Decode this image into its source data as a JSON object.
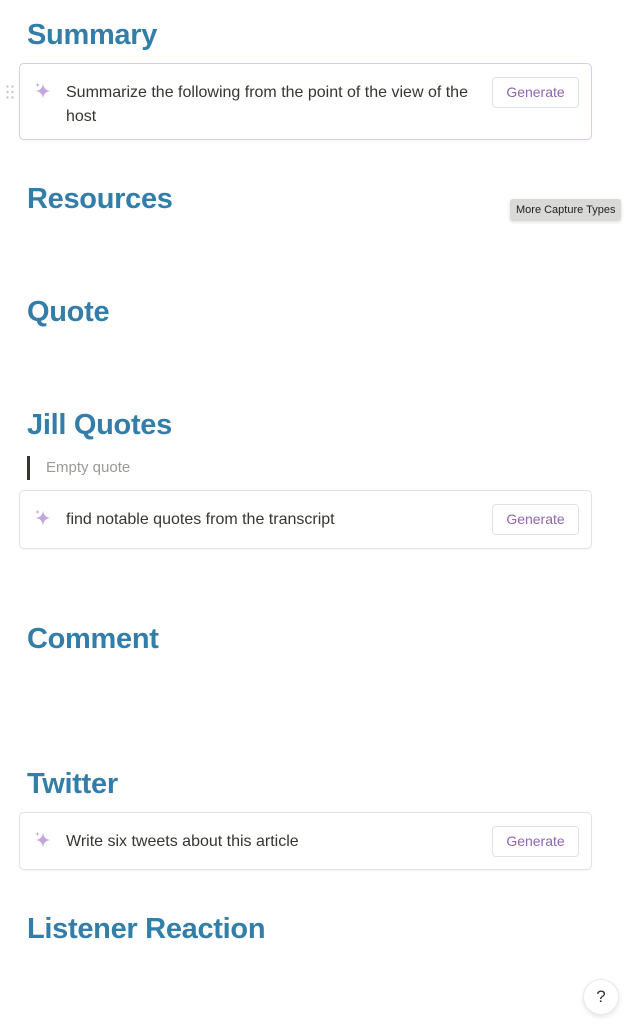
{
  "sections": {
    "summary": "Summary",
    "resources": "Resources",
    "quote": "Quote",
    "jill_quotes": "Jill Quotes",
    "comment": "Comment",
    "twitter": "Twitter",
    "listener_reaction": "Listener Reaction"
  },
  "ai_blocks": [
    {
      "prompt": "Summarize the following from the point of the view of the host",
      "button": "Generate"
    },
    {
      "prompt": "find notable quotes from the transcript",
      "button": "Generate"
    },
    {
      "prompt": "Write six tweets about this article",
      "button": "Generate"
    }
  ],
  "quote_placeholder": "Empty quote",
  "tooltip": "More Capture Types",
  "help_label": "?",
  "icons": {
    "ai": "sparkle-icon",
    "drag": "drag-handle-icon"
  },
  "colors": {
    "heading": "#337ea9",
    "accent": "#9065b0"
  }
}
